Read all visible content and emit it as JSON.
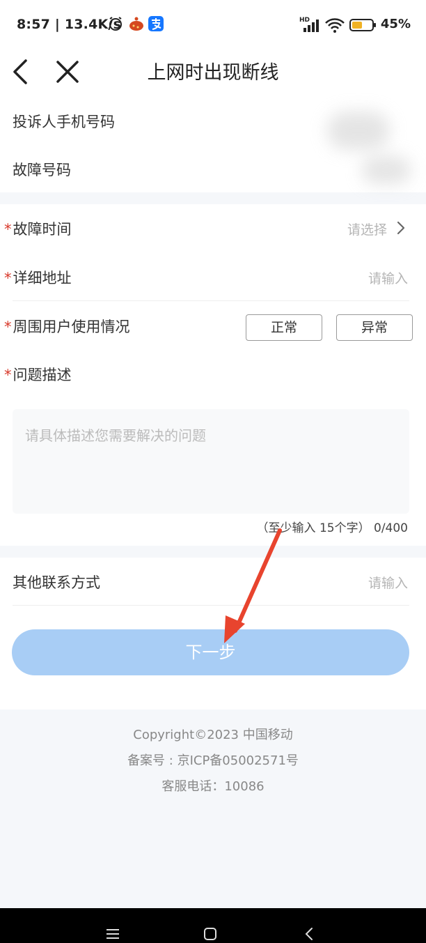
{
  "status_bar": {
    "time": "8:57 | 13.4K/s",
    "battery": "45%",
    "network_badge": "HD",
    "icons": [
      "alarm-icon",
      "app-icon",
      "alipay-icon",
      "signal-icon",
      "wifi-icon",
      "battery-icon"
    ]
  },
  "nav": {
    "title": "上网时出现断线",
    "back_icon": "chevron-left-icon",
    "close_icon": "close-icon"
  },
  "info": {
    "phone_label": "投诉人手机号码",
    "fault_number_label": "故障号码"
  },
  "form": {
    "required_mark": "*",
    "fault_time_label": "故障时间",
    "fault_time_placeholder": "请选择",
    "address_label": "详细地址",
    "address_placeholder": "请输入",
    "neighbors_label": "周围用户使用情况",
    "option_normal": "正常",
    "option_abnormal": "异常",
    "description_label": "问题描述",
    "description_placeholder": "请具体描述您需要解决的问题",
    "counter_hint": "（至少输入 15个字）",
    "counter_value": "0/400"
  },
  "contact": {
    "label": "其他联系方式",
    "placeholder": "请输入"
  },
  "next_button": "下一步",
  "footer": {
    "copyright": "Copyright©2023 中国移动",
    "icp": "备案号 : 京ICP备05002571号",
    "hotline": "客服电话：10086"
  },
  "colors": {
    "accent_button": "#a8cdf5",
    "required": "#d8392b",
    "arrow": "#e8442e"
  }
}
